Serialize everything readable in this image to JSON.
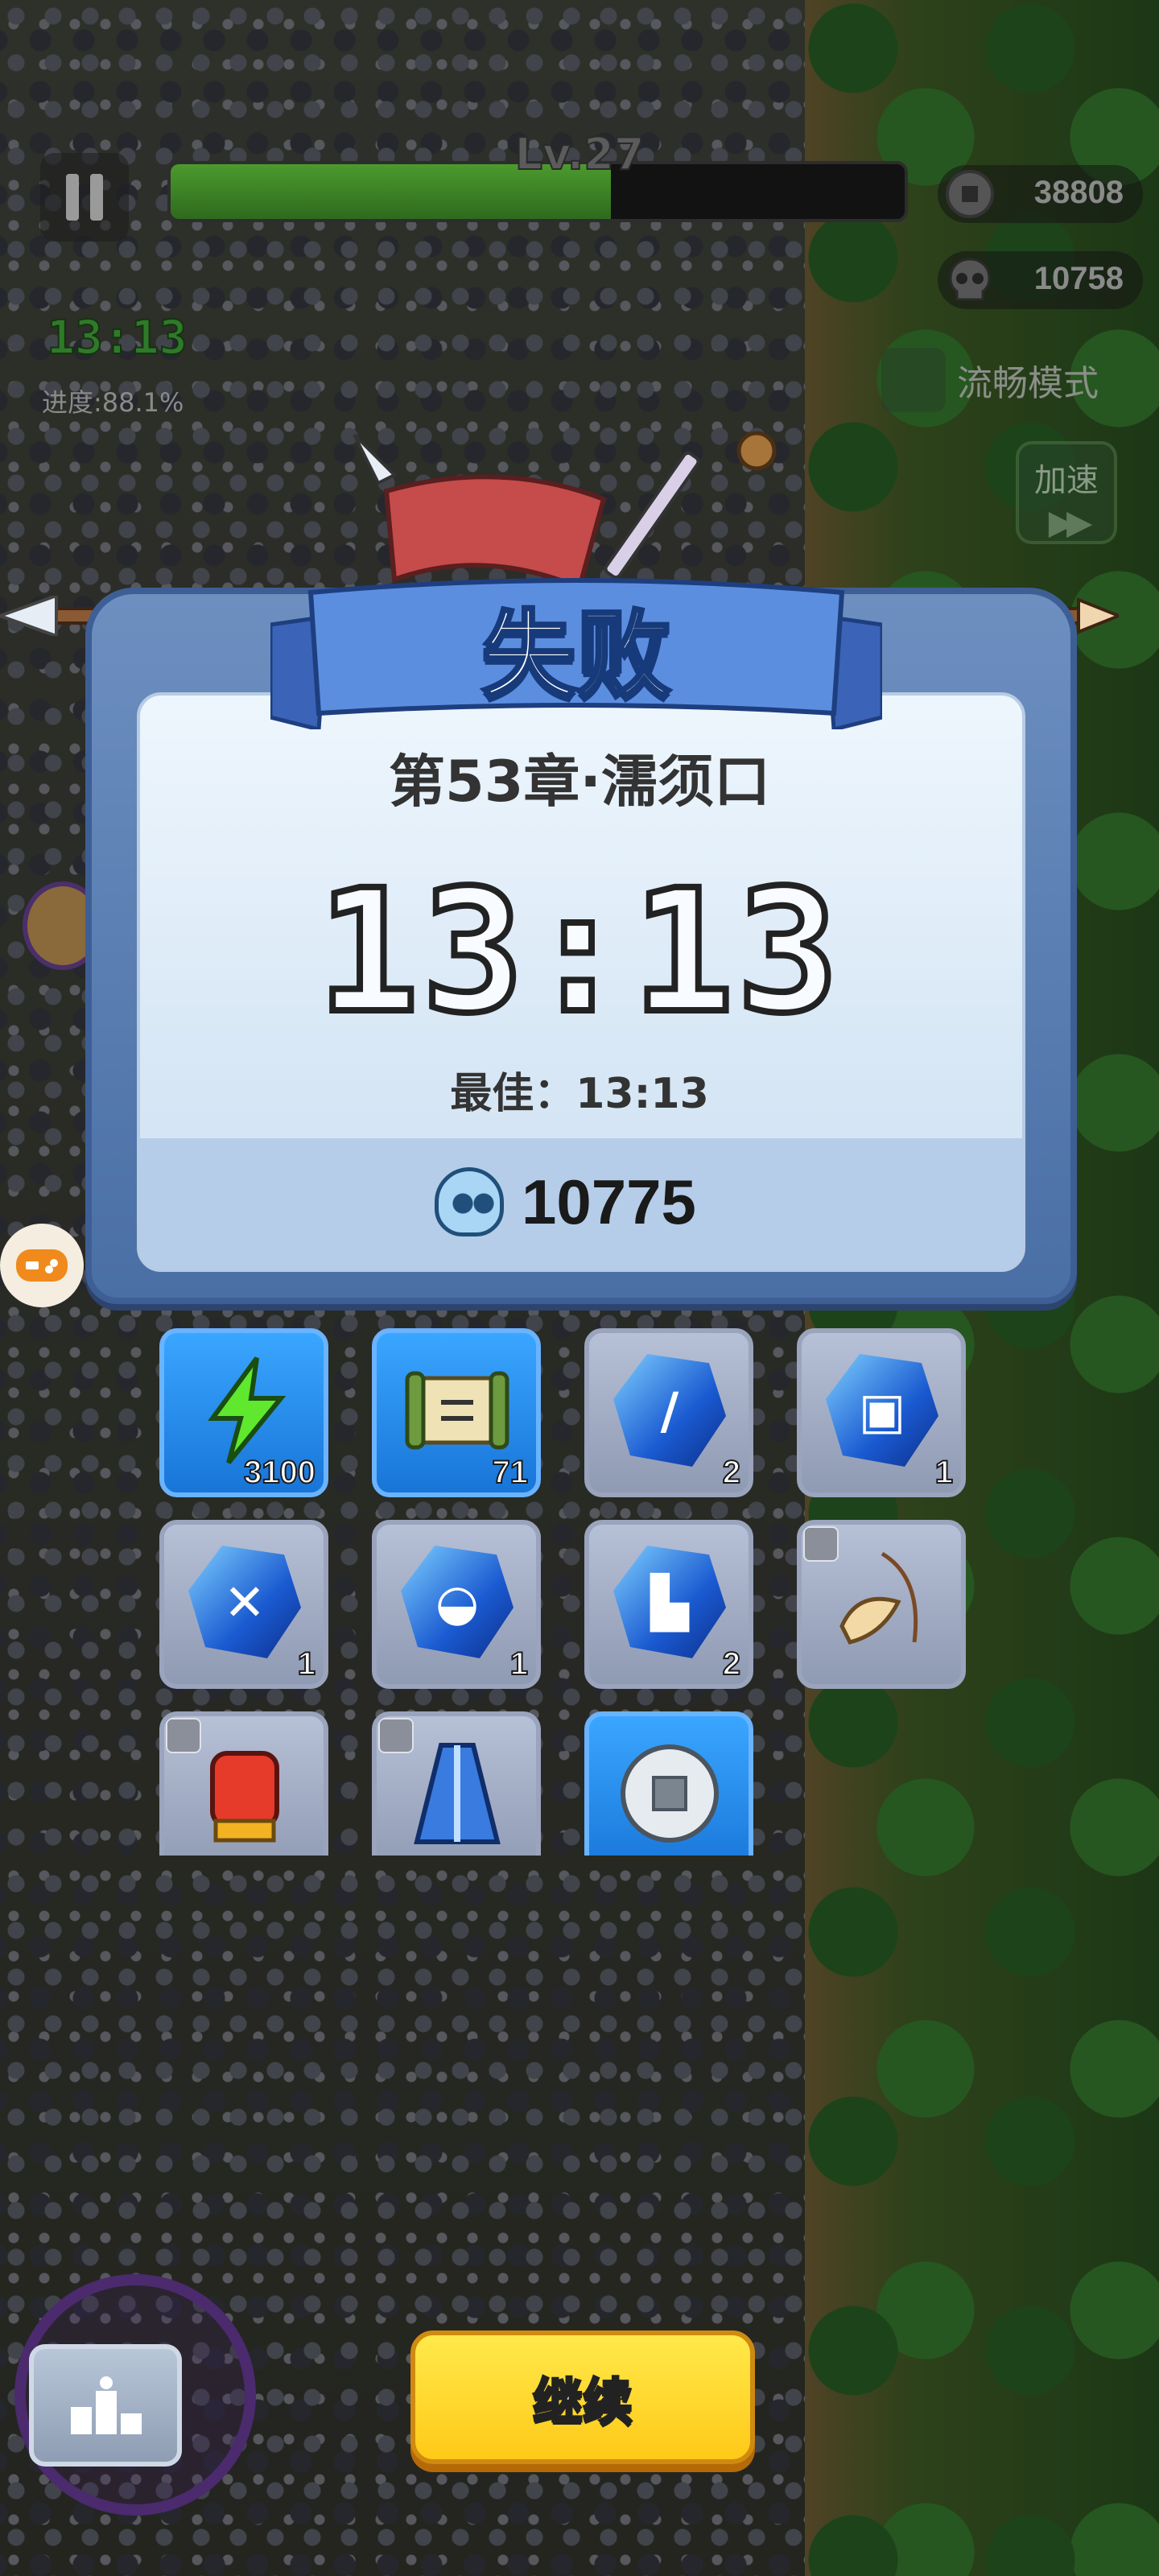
{
  "hud": {
    "level_label": "Lv.27",
    "level_progress": 0.6,
    "currency_value": "38808",
    "currency_icon": "coin-icon",
    "kill_count_value": "10758",
    "kill_icon": "skull-icon",
    "timer": "13:13",
    "progress_label": "进度:88.1%",
    "smooth_mode_label": "流畅模式",
    "speed_label": "加速",
    "speed_icon": "fast-forward-icon"
  },
  "result": {
    "title": "失败",
    "chapter": "第53章·濡须口",
    "time": "13:13",
    "best": "最佳：13:13",
    "kills": "10775"
  },
  "rewards": [
    {
      "icon": "energy-bolt-icon",
      "count": "3100",
      "style": "blue"
    },
    {
      "icon": "scroll-icon",
      "count": "71",
      "style": "blue"
    },
    {
      "icon": "blue-gem-weapon-icon",
      "count": "2",
      "style": "gray"
    },
    {
      "icon": "blue-gem-armor-icon",
      "count": "1",
      "style": "gray"
    },
    {
      "icon": "blue-gem-swords-icon",
      "count": "1",
      "style": "gray"
    },
    {
      "icon": "blue-gem-helmet-icon",
      "count": "1",
      "style": "gray"
    },
    {
      "icon": "blue-gem-boots-icon",
      "count": "2",
      "style": "gray"
    },
    {
      "icon": "horn-necklace-icon",
      "count": "",
      "style": "gray"
    },
    {
      "icon": "red-gauntlet-icon",
      "count": "",
      "style": "gray"
    },
    {
      "icon": "blue-robe-icon",
      "count": "",
      "style": "gray"
    },
    {
      "icon": "silver-coin-icon",
      "count": "",
      "style": "blue"
    }
  ],
  "bottom": {
    "continue_label": "继续",
    "stats_icon": "podium-icon"
  },
  "colors": {
    "panel_blue": "#4a6fa5",
    "continue_yellow": "#ffd21f",
    "reward_blue": "#2a8ef0"
  }
}
